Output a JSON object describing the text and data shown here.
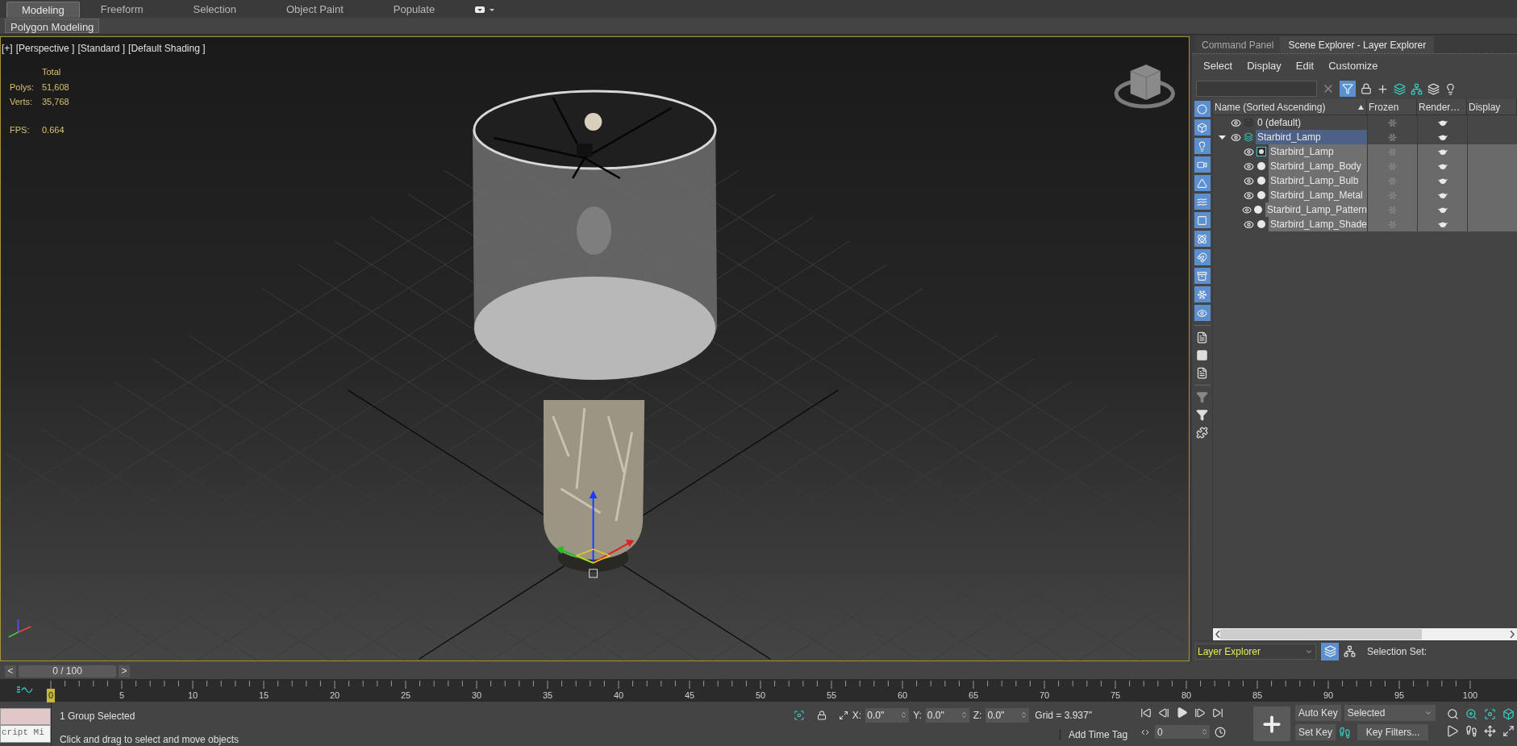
{
  "ribbon": {
    "tabs": [
      {
        "label": "Modeling",
        "selected": true
      },
      {
        "label": "Freeform",
        "selected": false
      },
      {
        "label": "Selection",
        "selected": false
      },
      {
        "label": "Object Paint",
        "selected": false
      },
      {
        "label": "Populate",
        "selected": false
      }
    ],
    "panel_button": "Polygon Modeling"
  },
  "viewport": {
    "labels": [
      "[+]",
      "[Perspective ]",
      "[Standard ]",
      "[Default Shading ]"
    ],
    "stats": {
      "header": "Total",
      "rows": [
        {
          "label": "Polys:",
          "value": "51,608"
        },
        {
          "label": "Verts:",
          "value": "35,768"
        }
      ],
      "fps_label": "FPS:",
      "fps": "0.664"
    }
  },
  "side_panel": {
    "tabs": [
      {
        "label": "Command Panel",
        "selected": false
      },
      {
        "label": "Scene Explorer - Layer Explorer",
        "selected": true
      }
    ],
    "menu": [
      "Select",
      "Display",
      "Edit",
      "Customize"
    ],
    "filter_on": true,
    "category_filters": [
      {
        "on": true
      },
      {
        "on": true
      },
      {
        "on": true
      },
      {
        "on": true
      },
      {
        "on": true
      },
      {
        "on": true
      },
      {
        "on": true
      },
      {
        "on": true
      },
      {
        "on": true
      },
      {
        "on": true
      },
      {
        "on": true
      },
      {
        "on": true
      }
    ],
    "columns": [
      "Name (Sorted Ascending)",
      "Frozen",
      "Render…",
      "Display"
    ],
    "tree": [
      {
        "kind": "layer",
        "name": "0 (default)",
        "selected": false
      },
      {
        "kind": "layer",
        "name": "Starbird_Lamp",
        "selected": true,
        "expanded": true,
        "children": [
          {
            "kind": "group",
            "name": "Starbird_Lamp",
            "selected": true
          },
          {
            "kind": "object",
            "name": "Starbird_Lamp_Body",
            "selected": true
          },
          {
            "kind": "object",
            "name": "Starbird_Lamp_Bulb",
            "selected": true
          },
          {
            "kind": "object",
            "name": "Starbird_Lamp_Metal",
            "selected": true
          },
          {
            "kind": "object",
            "name": "Starbird_Lamp_Pattern",
            "selected": true
          },
          {
            "kind": "object",
            "name": "Starbird_Lamp_Shade",
            "selected": true
          }
        ]
      }
    ],
    "explorer": "Layer Explorer",
    "selection_set_label": "Selection Set:"
  },
  "timeline": {
    "prev": "<",
    "next": ">",
    "slider_text": "0 / 100",
    "ticks": [
      {
        "label": "0",
        "current": true
      },
      {
        "label": "5",
        "current": false
      },
      {
        "label": "10",
        "current": false
      },
      {
        "label": "15",
        "current": false
      },
      {
        "label": "20",
        "current": false
      },
      {
        "label": "25",
        "current": false
      },
      {
        "label": "30",
        "current": false
      },
      {
        "label": "35",
        "current": false
      },
      {
        "label": "40",
        "current": false
      },
      {
        "label": "45",
        "current": false
      },
      {
        "label": "50",
        "current": false
      },
      {
        "label": "55",
        "current": false
      },
      {
        "label": "60",
        "current": false
      },
      {
        "label": "65",
        "current": false
      },
      {
        "label": "70",
        "current": false
      },
      {
        "label": "75",
        "current": false
      },
      {
        "label": "80",
        "current": false
      },
      {
        "label": "85",
        "current": false
      },
      {
        "label": "90",
        "current": false
      },
      {
        "label": "95",
        "current": false
      },
      {
        "label": "100",
        "current": false
      }
    ]
  },
  "status": {
    "listener_text": "cript Mi",
    "messages": [
      "1 Group Selected",
      "Click and drag to select and move objects"
    ],
    "coords": [
      {
        "axis": "X:",
        "value": "0.0\""
      },
      {
        "axis": "Y:",
        "value": "0.0\""
      },
      {
        "axis": "Z:",
        "value": "0.0\""
      }
    ],
    "grid": "Grid = 3.937\"",
    "time_tag": "Add Time Tag",
    "frame": "0",
    "auto_key": "Auto Key",
    "key_mode": "Selected",
    "set_key": "Set Key",
    "key_filters": "Key Filters..."
  }
}
